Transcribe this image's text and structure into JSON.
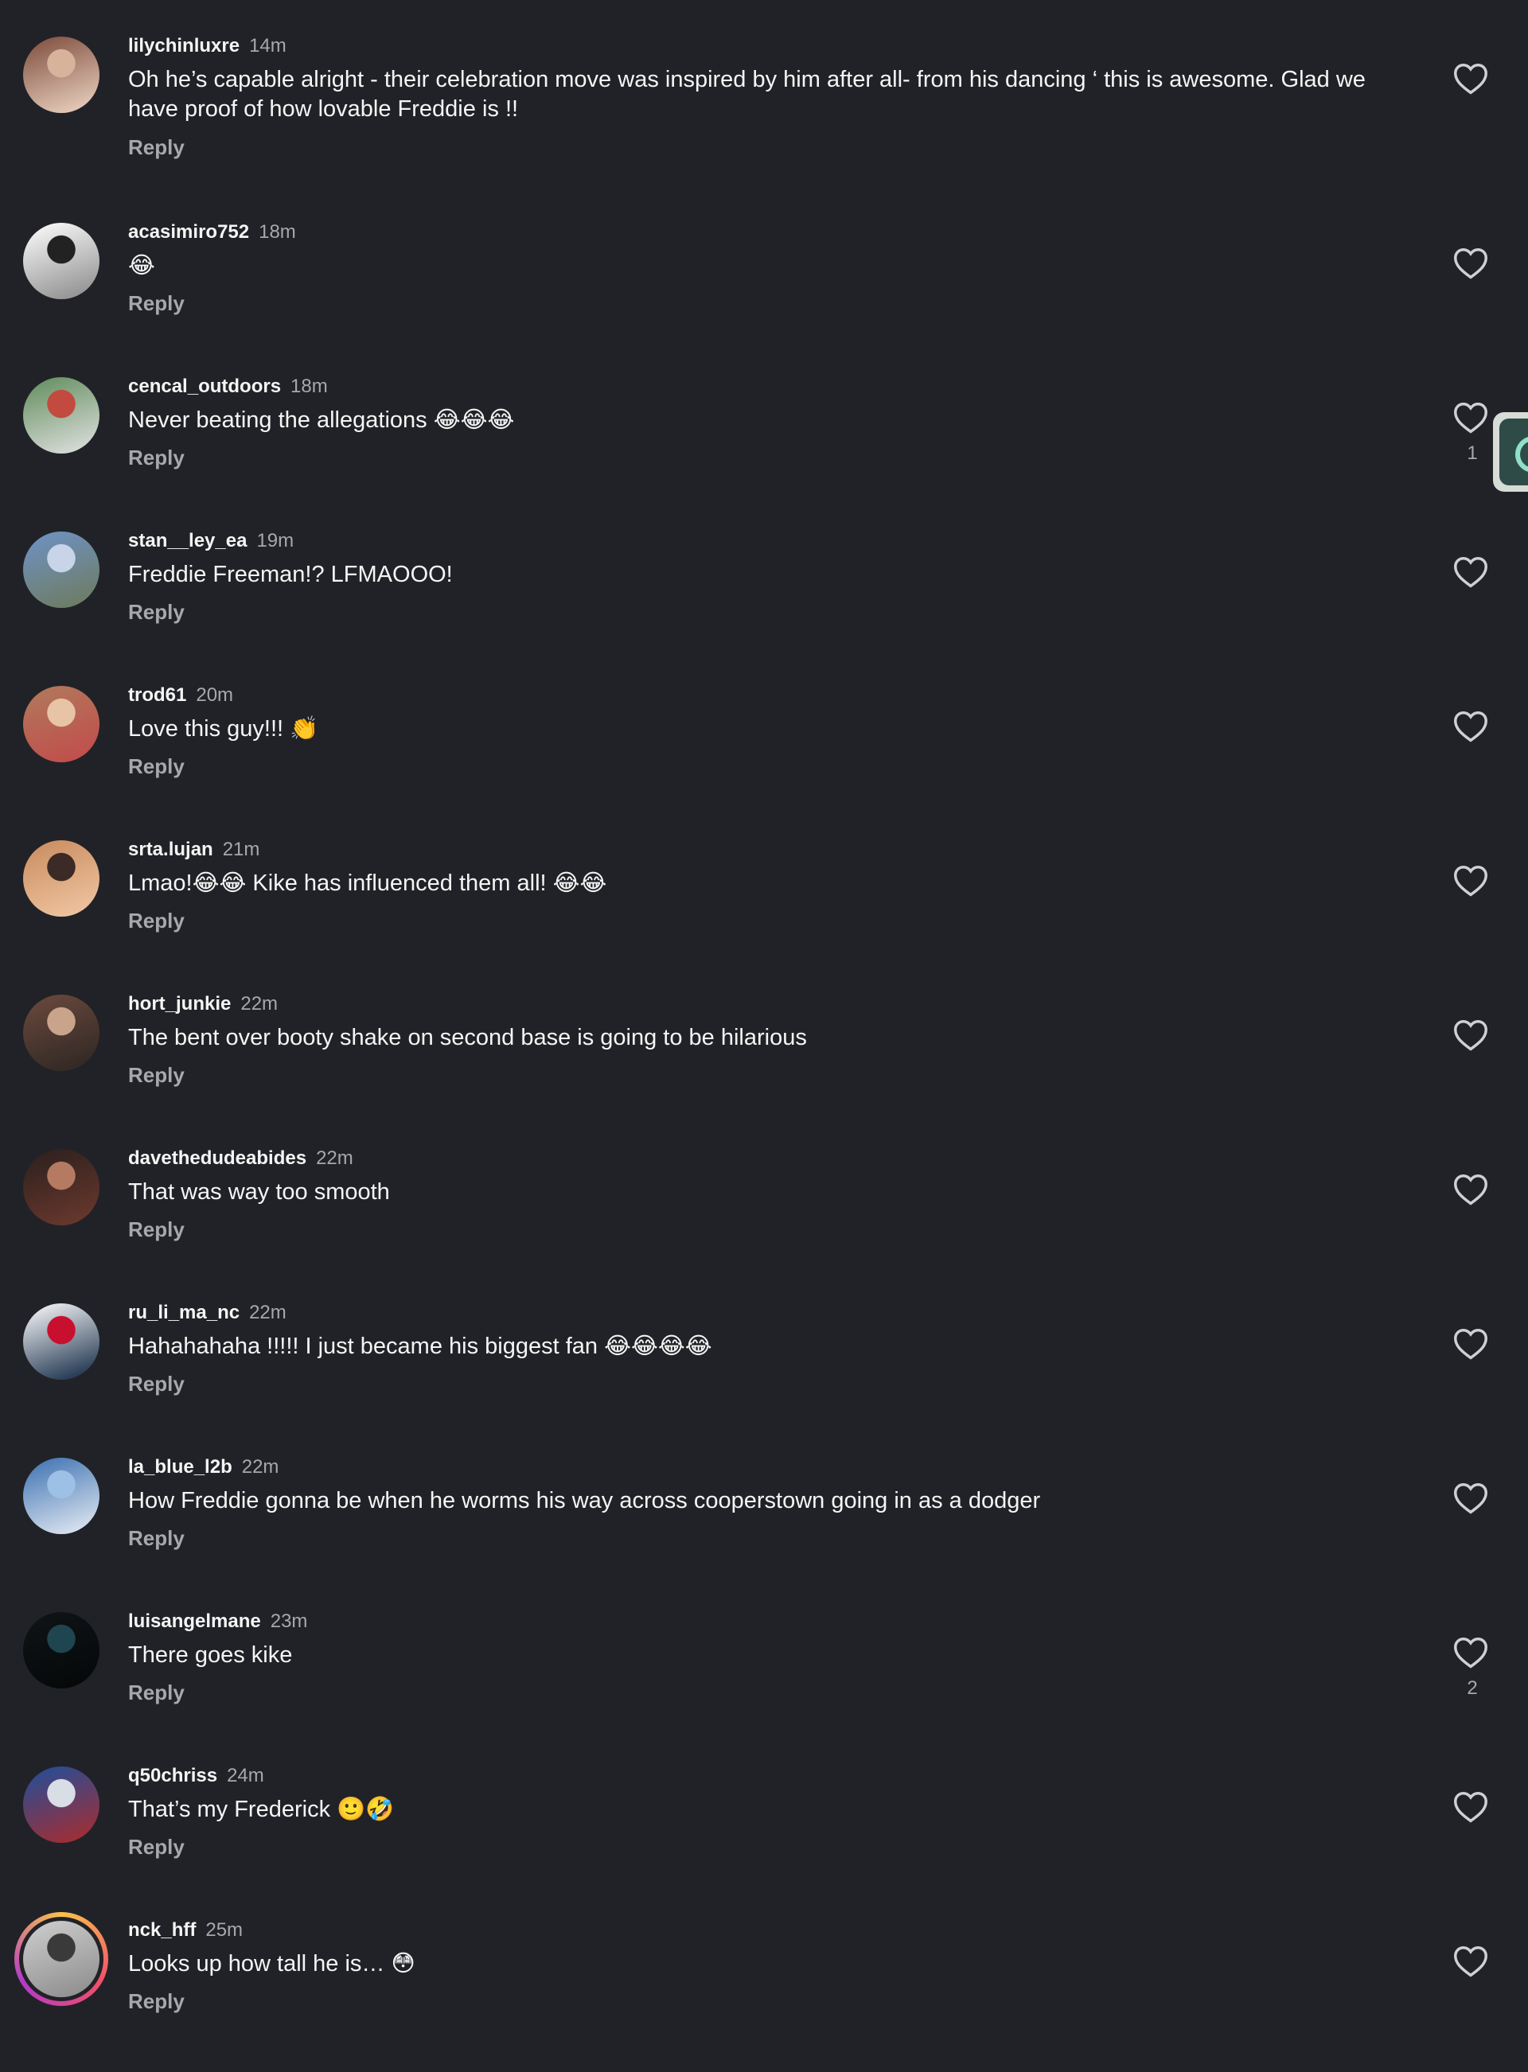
{
  "comments": [
    {
      "username": "lilychinluxre",
      "time": "14m",
      "text": "Oh he’s capable alright - their celebration move was inspired by him after all- from his dancing ‘ this is awesome. Glad we have proof of how lovable Freddie is !!",
      "reply": "Reply",
      "likes": "",
      "avatar_colors": [
        "#7b4a3a",
        "#d8b39b",
        "#f0d7c6"
      ]
    },
    {
      "username": "acasimiro752",
      "time": "18m",
      "text": "😂",
      "reply": "Reply",
      "likes": "",
      "avatar_colors": [
        "#ffffff",
        "#222222",
        "#888888"
      ]
    },
    {
      "username": "cencal_outdoors",
      "time": "18m",
      "text": "Never beating the allegations 😂😂😂",
      "reply": "Reply",
      "likes": "1",
      "avatar_colors": [
        "#5f8b5a",
        "#c24a3e",
        "#e3e3e3"
      ]
    },
    {
      "username": "stan__ley_ea",
      "time": "19m",
      "text": "Freddie Freeman!? LFMAOOO!",
      "reply": "Reply",
      "likes": "",
      "avatar_colors": [
        "#6f93c7",
        "#c8d4e8",
        "#6d7a5a"
      ]
    },
    {
      "username": "trod61",
      "time": "20m",
      "text": "Love this guy!!! 👏",
      "reply": "Reply",
      "likes": "",
      "avatar_colors": [
        "#b07a5d",
        "#e7c4a5",
        "#c34a4a"
      ]
    },
    {
      "username": "srta.lujan",
      "time": "21m",
      "text": "Lmao!😂😂 Kike has influenced them all! 😂😂",
      "reply": "Reply",
      "likes": "",
      "avatar_colors": [
        "#c88b5e",
        "#3b2a25",
        "#f2c8a5"
      ]
    },
    {
      "username": "hort_junkie",
      "time": "22m",
      "text": "The bent over booty shake on second base is going to be hilarious",
      "reply": "Reply",
      "likes": "",
      "avatar_colors": [
        "#6c4a3e",
        "#caa48a",
        "#2c2522"
      ]
    },
    {
      "username": "davethedudeabides",
      "time": "22m",
      "text": "That was way too smooth",
      "reply": "Reply",
      "likes": "",
      "avatar_colors": [
        "#2a1f1d",
        "#b57b62",
        "#6d3a2e"
      ]
    },
    {
      "username": "ru_li_ma_nc",
      "time": "22m",
      "text": "Hahahahaha !!!!! I just became his biggest fan 😂😂😂😂",
      "reply": "Reply",
      "likes": "",
      "avatar_colors": [
        "#ffffff",
        "#c8102e",
        "#0c2340"
      ]
    },
    {
      "username": "la_blue_l2b",
      "time": "22m",
      "text": "How Freddie gonna be when he worms his way across cooperstown going in as a dodger",
      "reply": "Reply",
      "likes": "",
      "avatar_colors": [
        "#3a6fb0",
        "#9cc0e6",
        "#e9eef5"
      ]
    },
    {
      "username": "luisangelmane",
      "time": "23m",
      "text": "There goes kike",
      "reply": "Reply",
      "likes": "2",
      "avatar_colors": [
        "#0f1416",
        "#1f4650",
        "#050708"
      ]
    },
    {
      "username": "q50chriss",
      "time": "24m",
      "text": "That’s my Frederick 🙂🤣",
      "reply": "Reply",
      "likes": "",
      "avatar_colors": [
        "#1e4f9c",
        "#d9dde5",
        "#ad2b2b"
      ]
    },
    {
      "username": "nck_hff",
      "time": "25m",
      "text": "Looks up how tall he is… 😳",
      "reply": "Reply",
      "likes": "",
      "avatar_colors": [
        "#cfcfcf",
        "#3a3a3a",
        "#8a8a8a"
      ]
    }
  ],
  "icons": {
    "like": "heart-outline-icon",
    "side": "floating-app-icon"
  },
  "colors": {
    "background": "#212227",
    "text": "#f5f5f5",
    "muted": "#a7a8ad"
  }
}
